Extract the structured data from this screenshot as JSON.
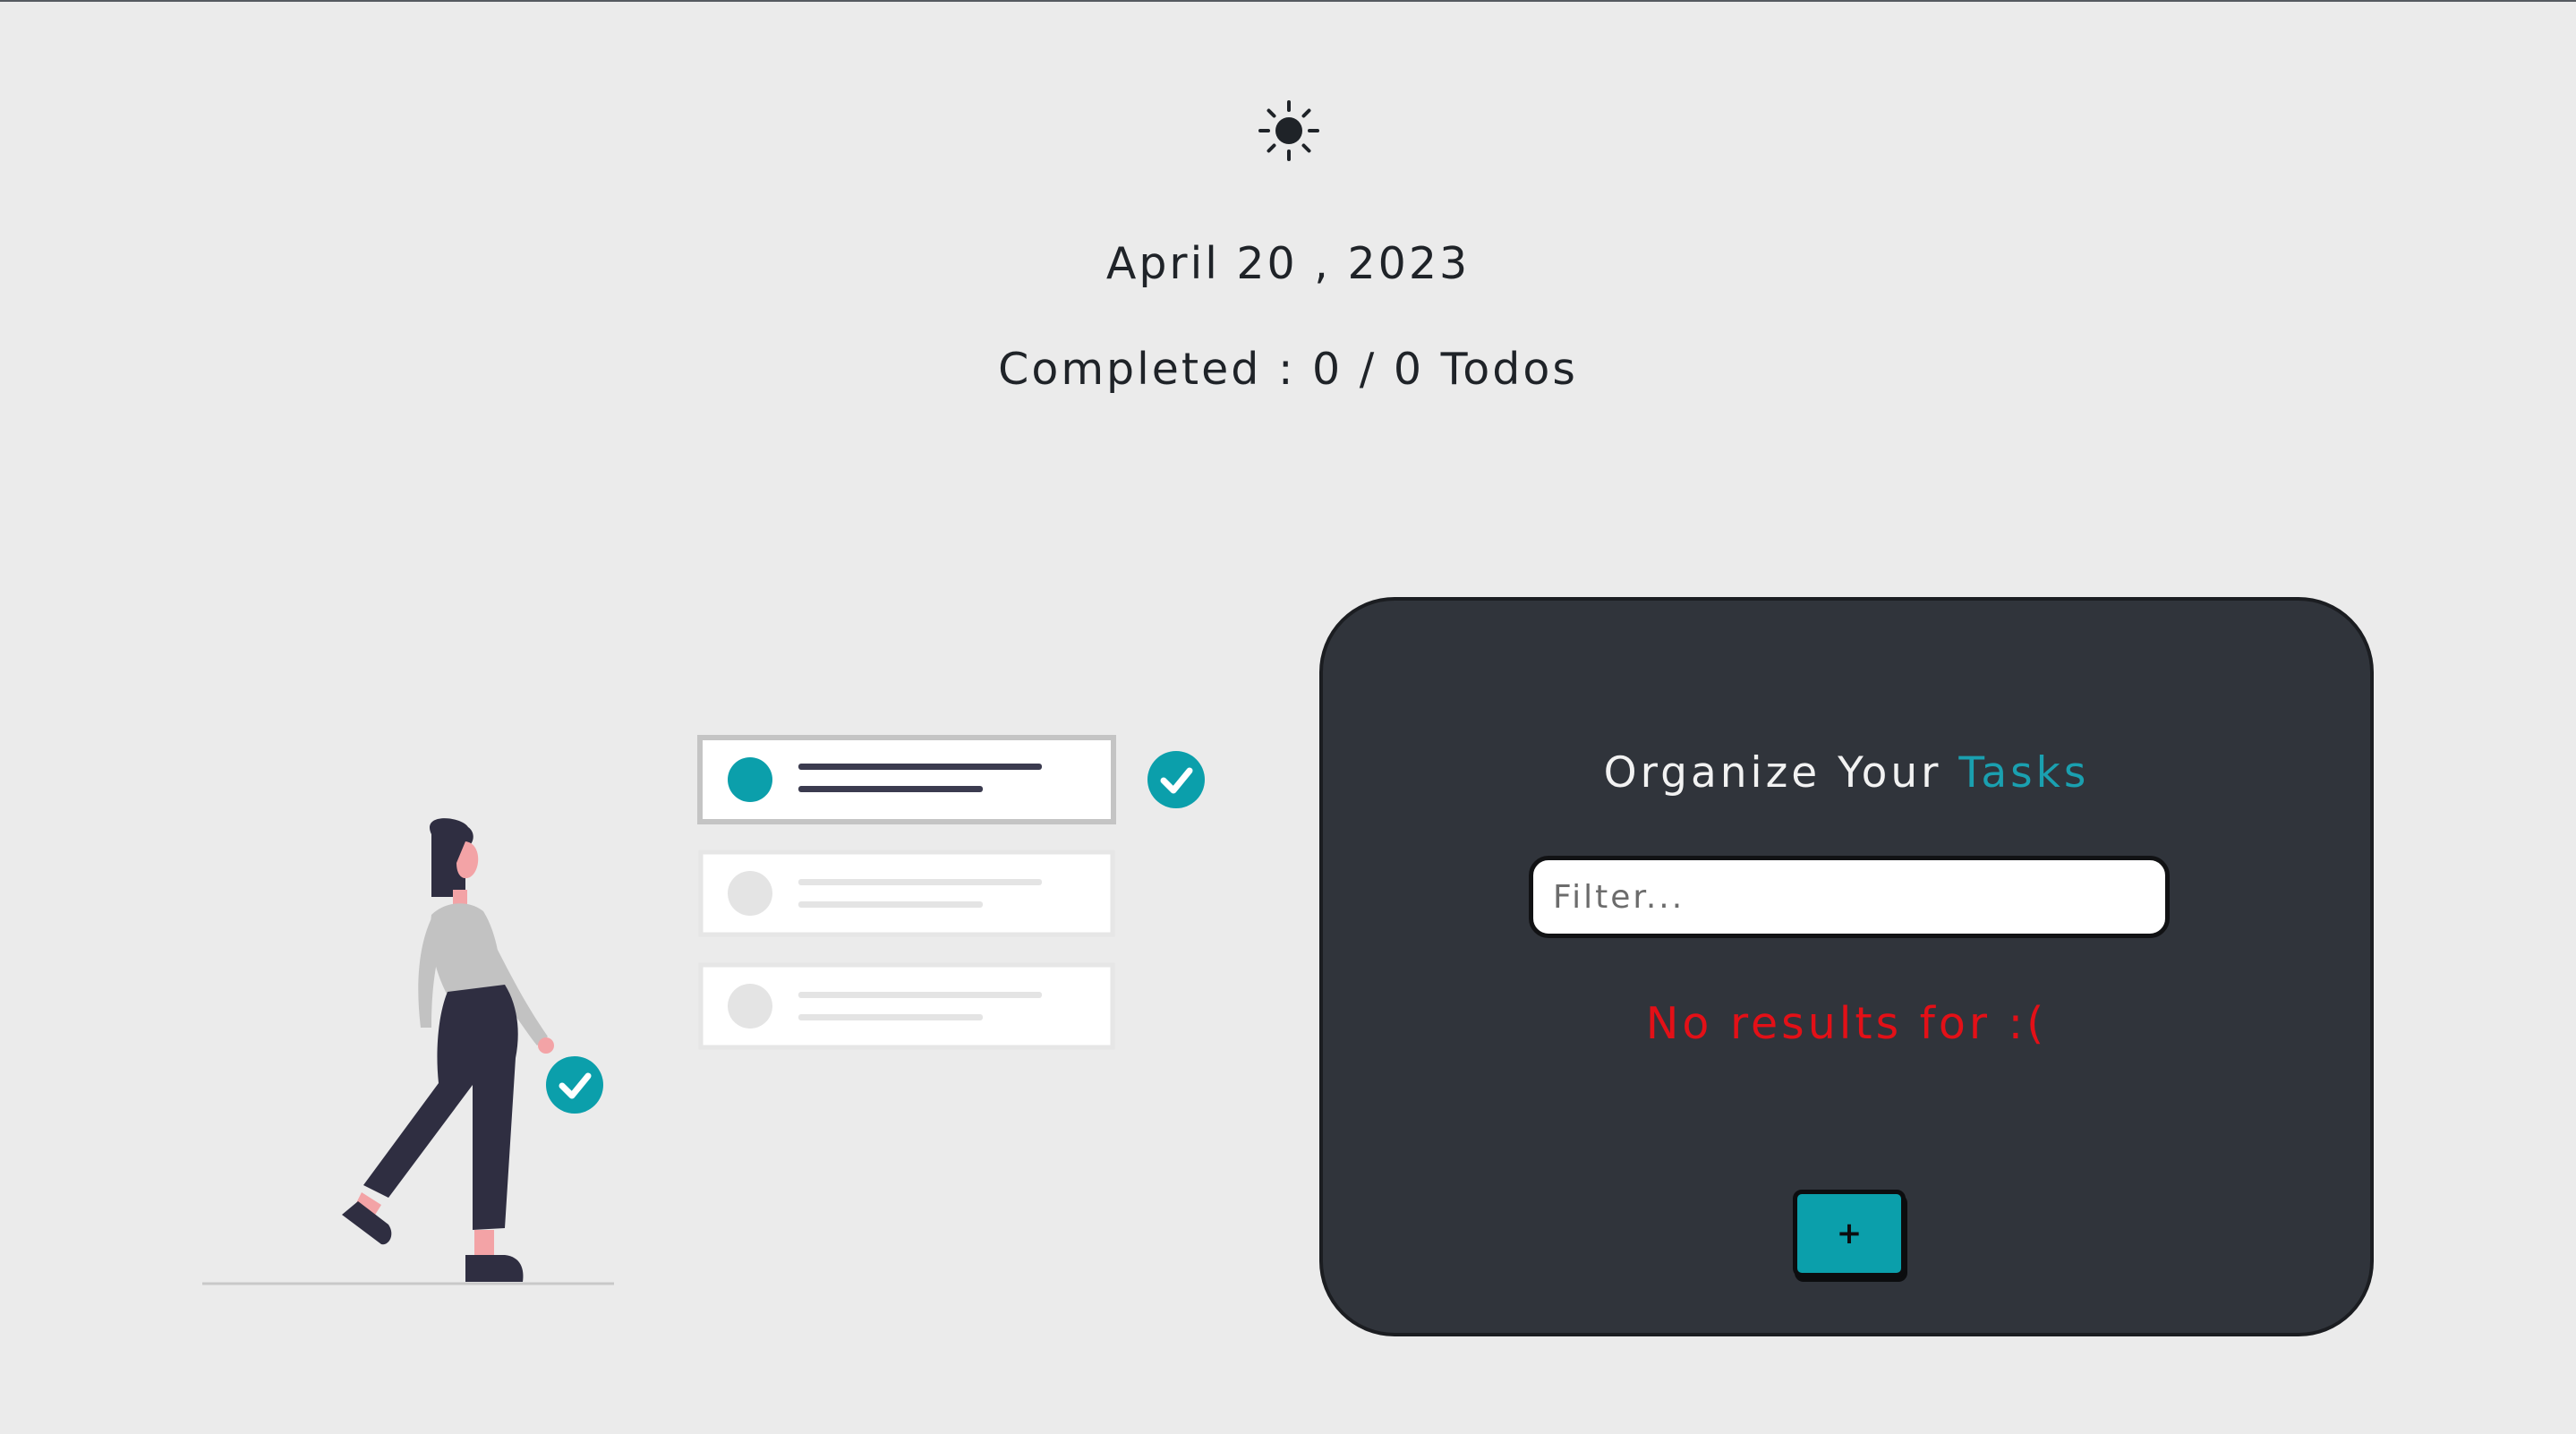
{
  "theme_toggle": {
    "icon": "sun-icon"
  },
  "header": {
    "date": "April 20 , 2023",
    "completed_label": "Completed : ",
    "completed_count": "0",
    "completed_separator": " / ",
    "total_count": "0",
    "completed_suffix": " Todos"
  },
  "panel": {
    "title_prefix": "Organize Your ",
    "title_accent": "Tasks",
    "filter_placeholder": "Filter...",
    "filter_value": "",
    "empty_message": "No results for :(",
    "add_button_label": "+"
  },
  "colors": {
    "background": "#ebebeb",
    "panel": "#30343b",
    "accent": "#0b9fab",
    "error": "#e31017",
    "text": "#1f2328"
  }
}
